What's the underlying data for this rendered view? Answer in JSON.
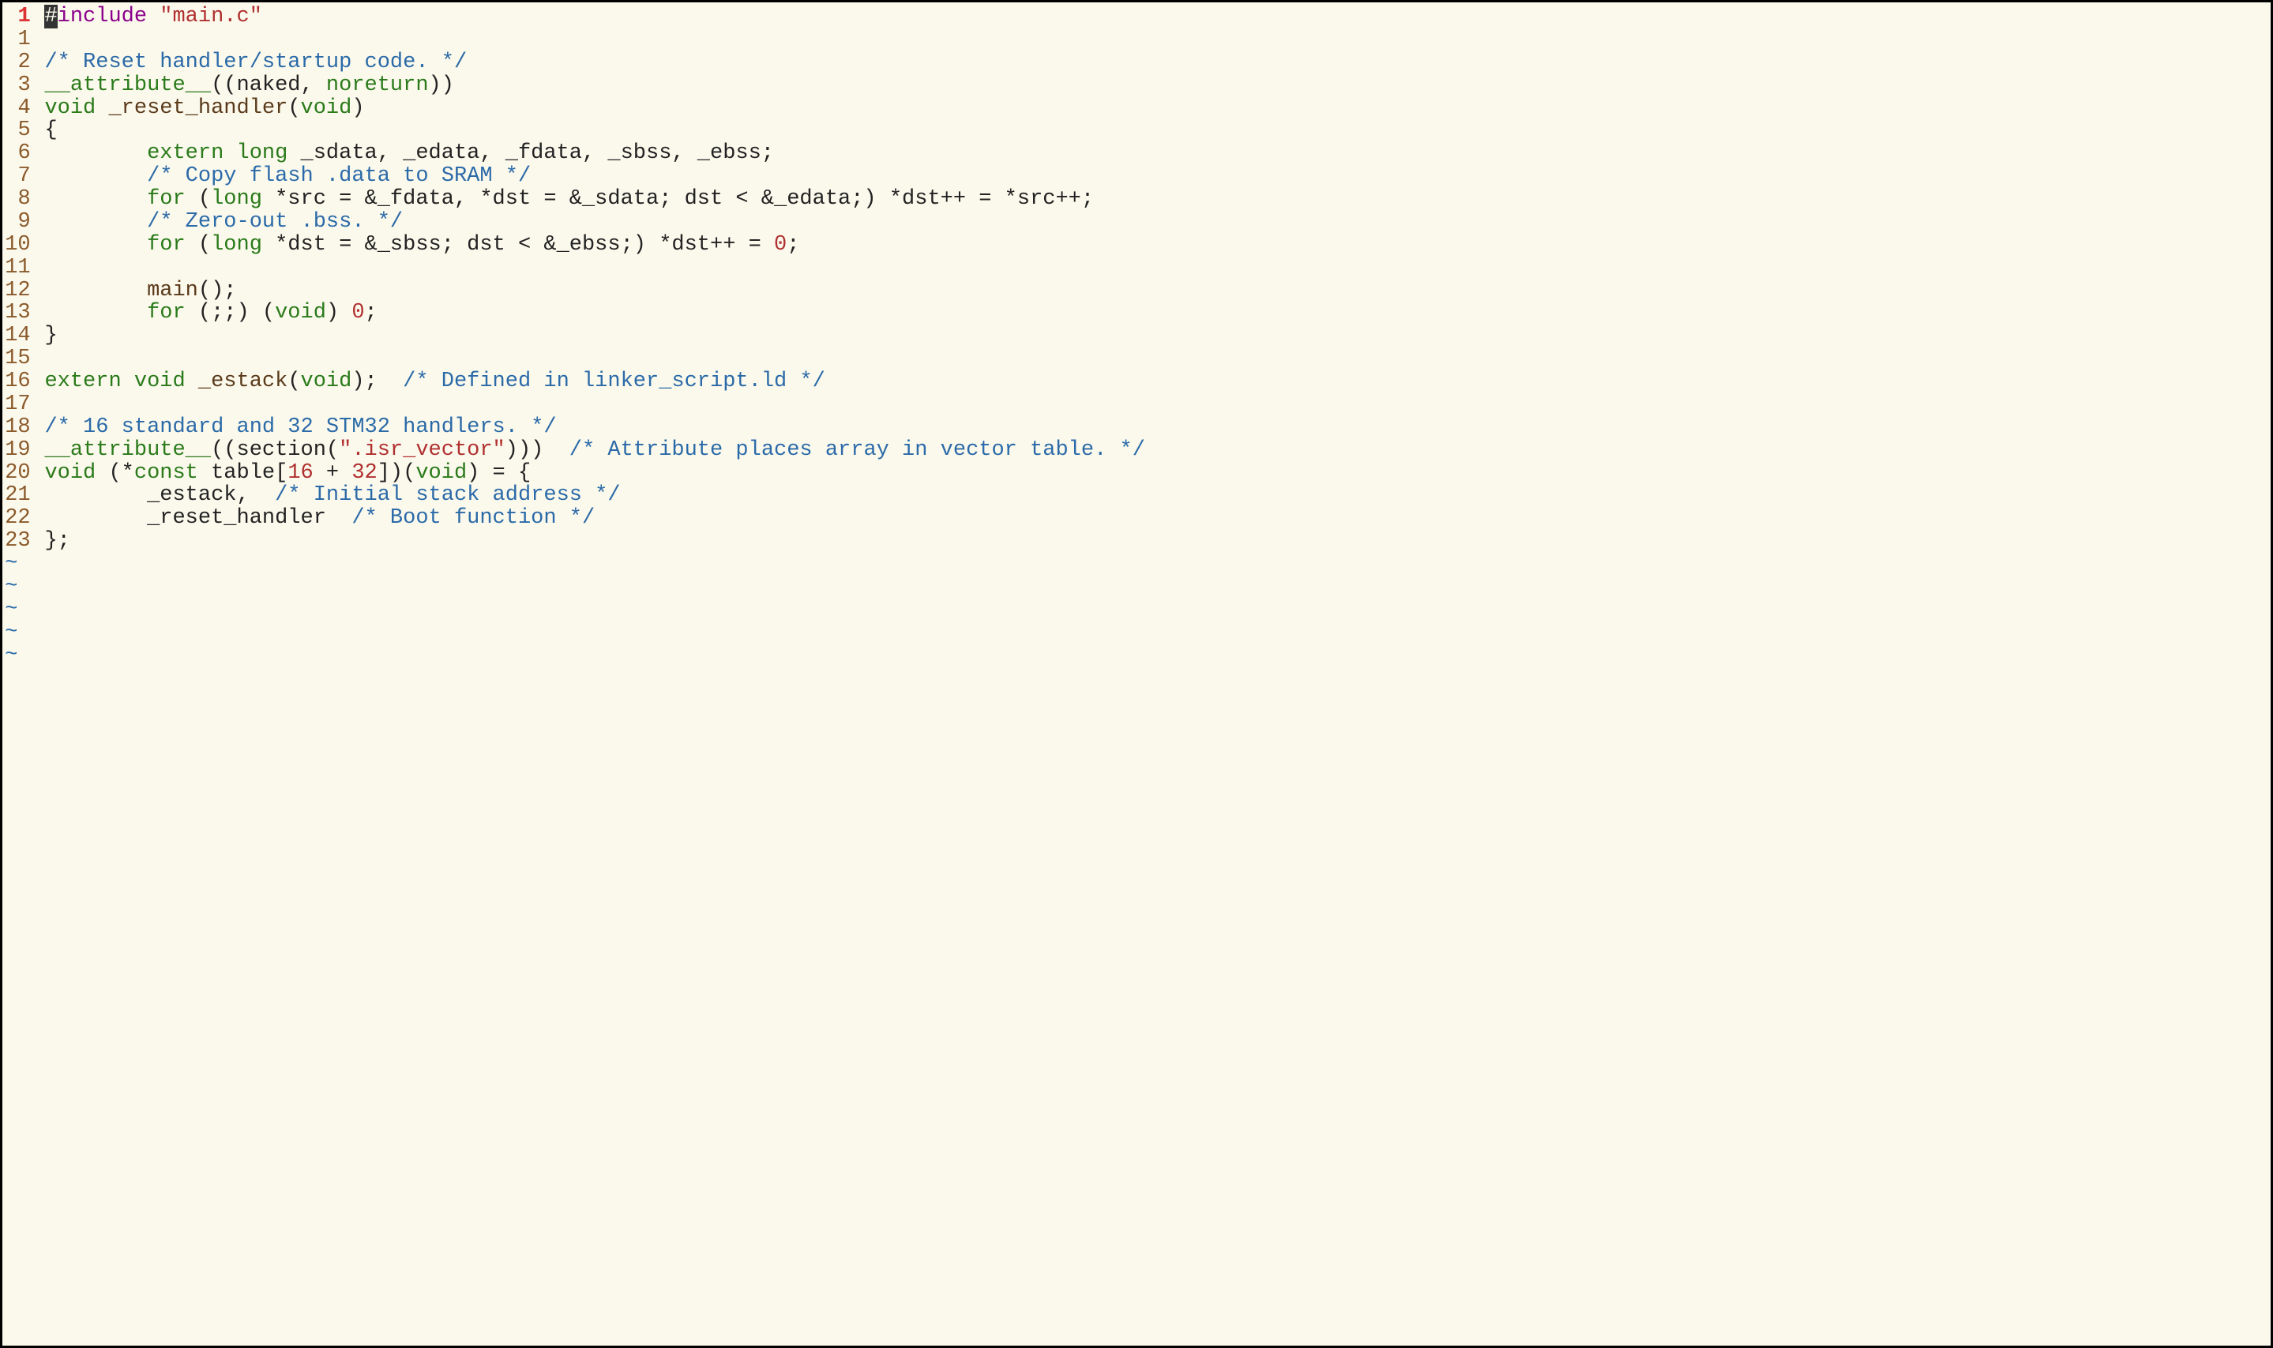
{
  "cursor_line_absolute": 1,
  "lines": [
    {
      "n": "1",
      "abs": true,
      "tokens": [
        {
          "cls": "cursor",
          "t": "#"
        },
        {
          "cls": "tok-preproc",
          "t": "include "
        },
        {
          "cls": "tok-string",
          "t": "\"main.c\""
        }
      ]
    },
    {
      "n": "1",
      "tokens": []
    },
    {
      "n": "2",
      "tokens": [
        {
          "cls": "tok-comment",
          "t": "/* Reset handler/startup code. */"
        }
      ]
    },
    {
      "n": "3",
      "tokens": [
        {
          "cls": "tok-keyword",
          "t": "__attribute__"
        },
        {
          "cls": "tok-plain",
          "t": "((naked, "
        },
        {
          "cls": "tok-keyword",
          "t": "noreturn"
        },
        {
          "cls": "tok-plain",
          "t": "))"
        }
      ]
    },
    {
      "n": "4",
      "tokens": [
        {
          "cls": "tok-keyword",
          "t": "void"
        },
        {
          "cls": "tok-plain",
          "t": " "
        },
        {
          "cls": "tok-func",
          "t": "_reset_handler"
        },
        {
          "cls": "tok-plain",
          "t": "("
        },
        {
          "cls": "tok-keyword",
          "t": "void"
        },
        {
          "cls": "tok-plain",
          "t": ")"
        }
      ]
    },
    {
      "n": "5",
      "tokens": [
        {
          "cls": "tok-plain",
          "t": "{"
        }
      ]
    },
    {
      "n": "6",
      "tokens": [
        {
          "cls": "tok-plain",
          "t": "        "
        },
        {
          "cls": "tok-keyword",
          "t": "extern"
        },
        {
          "cls": "tok-plain",
          "t": " "
        },
        {
          "cls": "tok-keyword",
          "t": "long"
        },
        {
          "cls": "tok-plain",
          "t": " _sdata, _edata, _fdata, _sbss, _ebss;"
        }
      ]
    },
    {
      "n": "7",
      "tokens": [
        {
          "cls": "tok-plain",
          "t": "        "
        },
        {
          "cls": "tok-comment",
          "t": "/* Copy flash .data to SRAM */"
        }
      ]
    },
    {
      "n": "8",
      "tokens": [
        {
          "cls": "tok-plain",
          "t": "        "
        },
        {
          "cls": "tok-keyword",
          "t": "for"
        },
        {
          "cls": "tok-plain",
          "t": " ("
        },
        {
          "cls": "tok-keyword",
          "t": "long"
        },
        {
          "cls": "tok-plain",
          "t": " *src = &_fdata, *dst = &_sdata; dst < &_edata;) *dst++ = *src++;"
        }
      ]
    },
    {
      "n": "9",
      "tokens": [
        {
          "cls": "tok-plain",
          "t": "        "
        },
        {
          "cls": "tok-comment",
          "t": "/* Zero-out .bss. */"
        }
      ]
    },
    {
      "n": "10",
      "tokens": [
        {
          "cls": "tok-plain",
          "t": "        "
        },
        {
          "cls": "tok-keyword",
          "t": "for"
        },
        {
          "cls": "tok-plain",
          "t": " ("
        },
        {
          "cls": "tok-keyword",
          "t": "long"
        },
        {
          "cls": "tok-plain",
          "t": " *dst = &_sbss; dst < &_ebss;) *dst++ = "
        },
        {
          "cls": "tok-number",
          "t": "0"
        },
        {
          "cls": "tok-plain",
          "t": ";"
        }
      ]
    },
    {
      "n": "11",
      "tokens": []
    },
    {
      "n": "12",
      "tokens": [
        {
          "cls": "tok-plain",
          "t": "        "
        },
        {
          "cls": "tok-func",
          "t": "main"
        },
        {
          "cls": "tok-plain",
          "t": "();"
        }
      ]
    },
    {
      "n": "13",
      "tokens": [
        {
          "cls": "tok-plain",
          "t": "        "
        },
        {
          "cls": "tok-keyword",
          "t": "for"
        },
        {
          "cls": "tok-plain",
          "t": " (;;) ("
        },
        {
          "cls": "tok-keyword",
          "t": "void"
        },
        {
          "cls": "tok-plain",
          "t": ") "
        },
        {
          "cls": "tok-number",
          "t": "0"
        },
        {
          "cls": "tok-plain",
          "t": ";"
        }
      ]
    },
    {
      "n": "14",
      "tokens": [
        {
          "cls": "tok-plain",
          "t": "}"
        }
      ]
    },
    {
      "n": "15",
      "tokens": []
    },
    {
      "n": "16",
      "tokens": [
        {
          "cls": "tok-keyword",
          "t": "extern"
        },
        {
          "cls": "tok-plain",
          "t": " "
        },
        {
          "cls": "tok-keyword",
          "t": "void"
        },
        {
          "cls": "tok-plain",
          "t": " "
        },
        {
          "cls": "tok-func",
          "t": "_estack"
        },
        {
          "cls": "tok-plain",
          "t": "("
        },
        {
          "cls": "tok-keyword",
          "t": "void"
        },
        {
          "cls": "tok-plain",
          "t": ");  "
        },
        {
          "cls": "tok-comment",
          "t": "/* Defined in linker_script.ld */"
        }
      ]
    },
    {
      "n": "17",
      "tokens": []
    },
    {
      "n": "18",
      "tokens": [
        {
          "cls": "tok-comment",
          "t": "/* 16 standard and 32 STM32 handlers. */"
        }
      ]
    },
    {
      "n": "19",
      "tokens": [
        {
          "cls": "tok-keyword",
          "t": "__attribute__"
        },
        {
          "cls": "tok-plain",
          "t": "((section("
        },
        {
          "cls": "tok-string",
          "t": "\".isr_vector\""
        },
        {
          "cls": "tok-plain",
          "t": ")))  "
        },
        {
          "cls": "tok-comment",
          "t": "/* Attribute places array in vector table. */"
        }
      ]
    },
    {
      "n": "20",
      "tokens": [
        {
          "cls": "tok-keyword",
          "t": "void"
        },
        {
          "cls": "tok-plain",
          "t": " (*"
        },
        {
          "cls": "tok-keyword",
          "t": "const"
        },
        {
          "cls": "tok-plain",
          "t": " table["
        },
        {
          "cls": "tok-number",
          "t": "16"
        },
        {
          "cls": "tok-plain",
          "t": " + "
        },
        {
          "cls": "tok-number",
          "t": "32"
        },
        {
          "cls": "tok-plain",
          "t": "])("
        },
        {
          "cls": "tok-keyword",
          "t": "void"
        },
        {
          "cls": "tok-plain",
          "t": ") = {"
        }
      ]
    },
    {
      "n": "21",
      "tokens": [
        {
          "cls": "tok-plain",
          "t": "        _estack,  "
        },
        {
          "cls": "tok-comment",
          "t": "/* Initial stack address */"
        }
      ]
    },
    {
      "n": "22",
      "tokens": [
        {
          "cls": "tok-plain",
          "t": "        _reset_handler  "
        },
        {
          "cls": "tok-comment",
          "t": "/* Boot function */"
        }
      ]
    },
    {
      "n": "23",
      "tokens": [
        {
          "cls": "tok-plain",
          "t": "};"
        }
      ]
    }
  ],
  "tilde_rows": 5,
  "tilde_char": "~"
}
